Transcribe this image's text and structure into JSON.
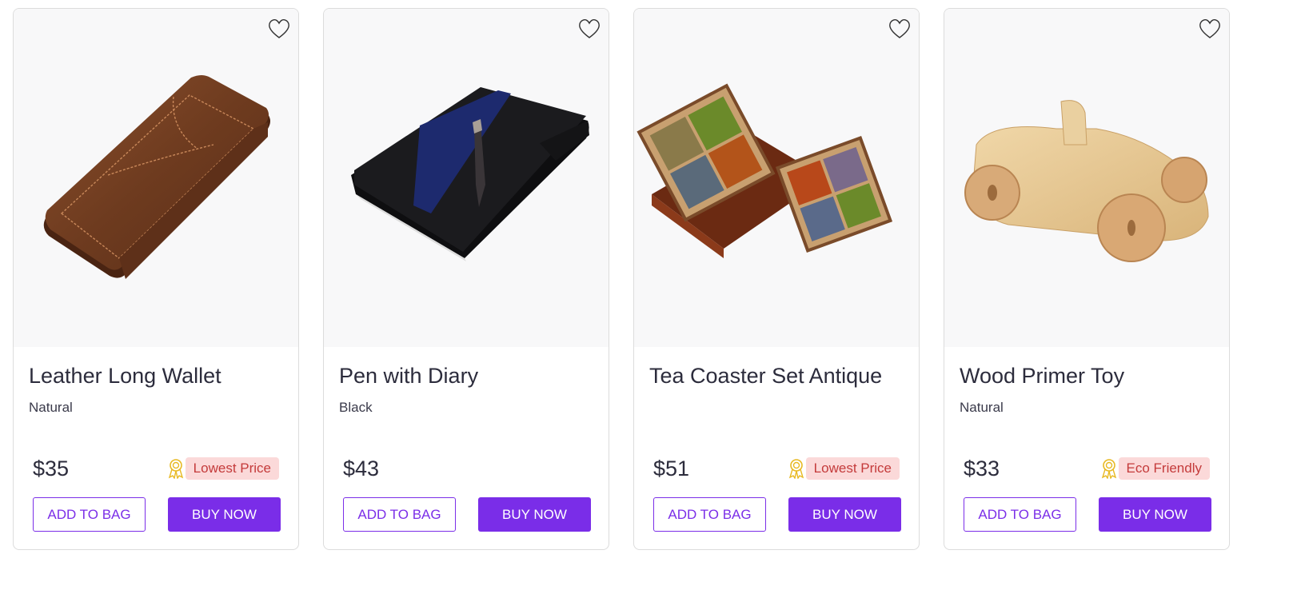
{
  "colors": {
    "accent": "#7a2de8",
    "badge_bg": "#fbd9d9",
    "badge_text": "#c43b3b",
    "medal": "#e8b923"
  },
  "products": [
    {
      "title": "Leather Long Wallet",
      "subtitle": "Natural",
      "price": "$35",
      "badge": "Lowest Price",
      "add_label": "ADD TO BAG",
      "buy_label": "BUY NOW",
      "wishlist_icon": "heart-outline-icon"
    },
    {
      "title": "Pen with Diary",
      "subtitle": "Black",
      "price": "$43",
      "badge": "",
      "add_label": "ADD TO BAG",
      "buy_label": "BUY NOW",
      "wishlist_icon": "heart-outline-icon"
    },
    {
      "title": "Tea Coaster Set Antique",
      "subtitle": "",
      "price": "$51",
      "badge": "Lowest Price",
      "add_label": "ADD TO BAG",
      "buy_label": "BUY NOW",
      "wishlist_icon": "heart-outline-icon"
    },
    {
      "title": "Wood Primer Toy",
      "subtitle": "Natural",
      "price": "$33",
      "badge": "Eco Friendly",
      "add_label": "ADD TO BAG",
      "buy_label": "BUY NOW",
      "wishlist_icon": "heart-outline-icon"
    }
  ]
}
